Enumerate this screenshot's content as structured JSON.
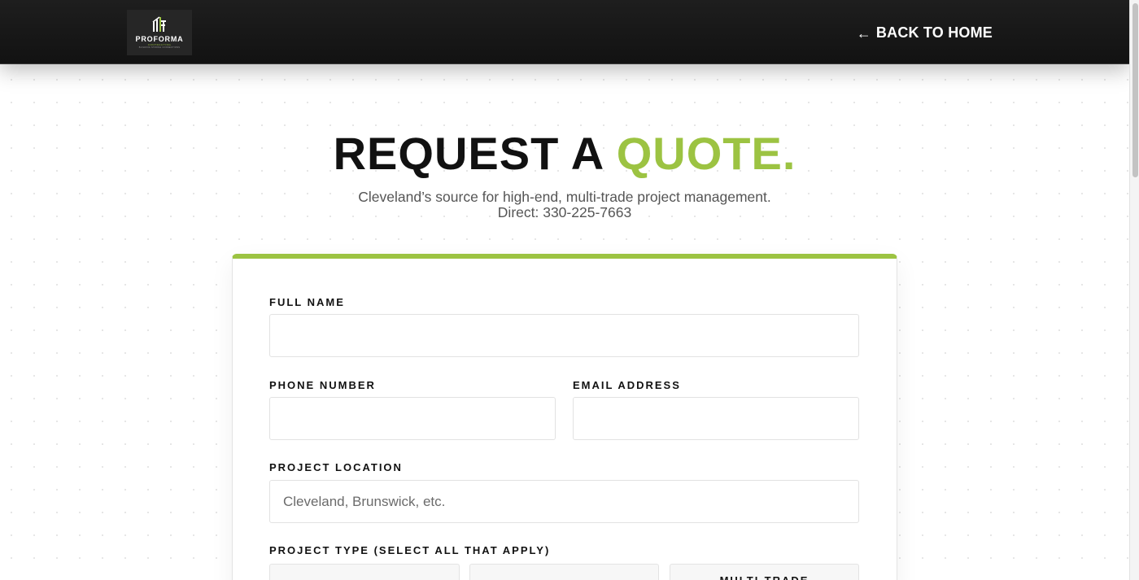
{
  "header": {
    "logo": {
      "wordmark": "PROFORMA",
      "subtitle": "CONTRACTING",
      "tagline": "BUILDING STRONG CONNECTIONS"
    },
    "back_link": {
      "arrow": "←",
      "label": "BACK TO HOME"
    }
  },
  "hero": {
    "title_main": "REQUEST A ",
    "title_accent": "QUOTE.",
    "subtitle_line1": "Cleveland’s source for high-end, multi-trade project management.",
    "subtitle_line2": "Direct: 330-225-7663"
  },
  "form": {
    "full_name": {
      "label": "FULL NAME",
      "value": "",
      "placeholder": ""
    },
    "phone": {
      "label": "PHONE NUMBER",
      "value": "",
      "placeholder": ""
    },
    "email": {
      "label": "EMAIL ADDRESS",
      "value": "",
      "placeholder": ""
    },
    "location": {
      "label": "PROJECT LOCATION",
      "value": "",
      "placeholder": "Cleveland, Brunswick, etc."
    },
    "project_type": {
      "label": "PROJECT TYPE (SELECT ALL THAT APPLY)",
      "options": [
        "",
        "",
        "MULTI-TRADE"
      ]
    }
  },
  "colors": {
    "accent": "#9cc342",
    "header_bg": "#1a1a1a",
    "text_dark": "#111111",
    "text_muted": "#555555"
  },
  "icons": {
    "back": "arrow-left-icon",
    "logo": "building-logo-icon"
  }
}
